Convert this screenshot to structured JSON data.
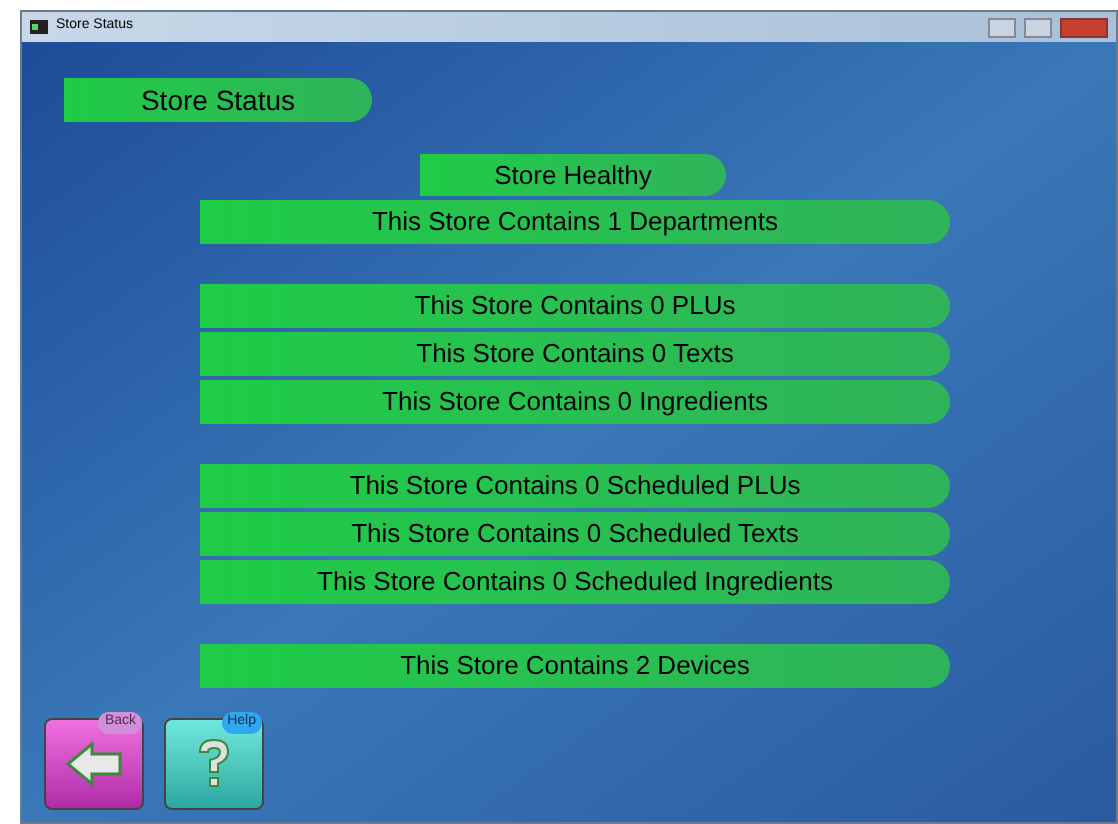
{
  "window": {
    "title": "Store Status"
  },
  "heading": "Store Status",
  "status": "Store Healthy",
  "groups": [
    [
      "This Store Contains 1 Departments"
    ],
    [
      "This Store Contains 0 PLUs",
      "This Store Contains 0 Texts",
      "This Store Contains 0 Ingredients"
    ],
    [
      "This Store Contains 0 Scheduled PLUs",
      "This Store Contains 0 Scheduled Texts",
      "This Store Contains 0 Scheduled Ingredients"
    ],
    [
      "This Store Contains 2 Devices"
    ]
  ],
  "buttons": [
    {
      "kind": "back",
      "label": "Back"
    },
    {
      "kind": "help",
      "label": "Help"
    }
  ]
}
